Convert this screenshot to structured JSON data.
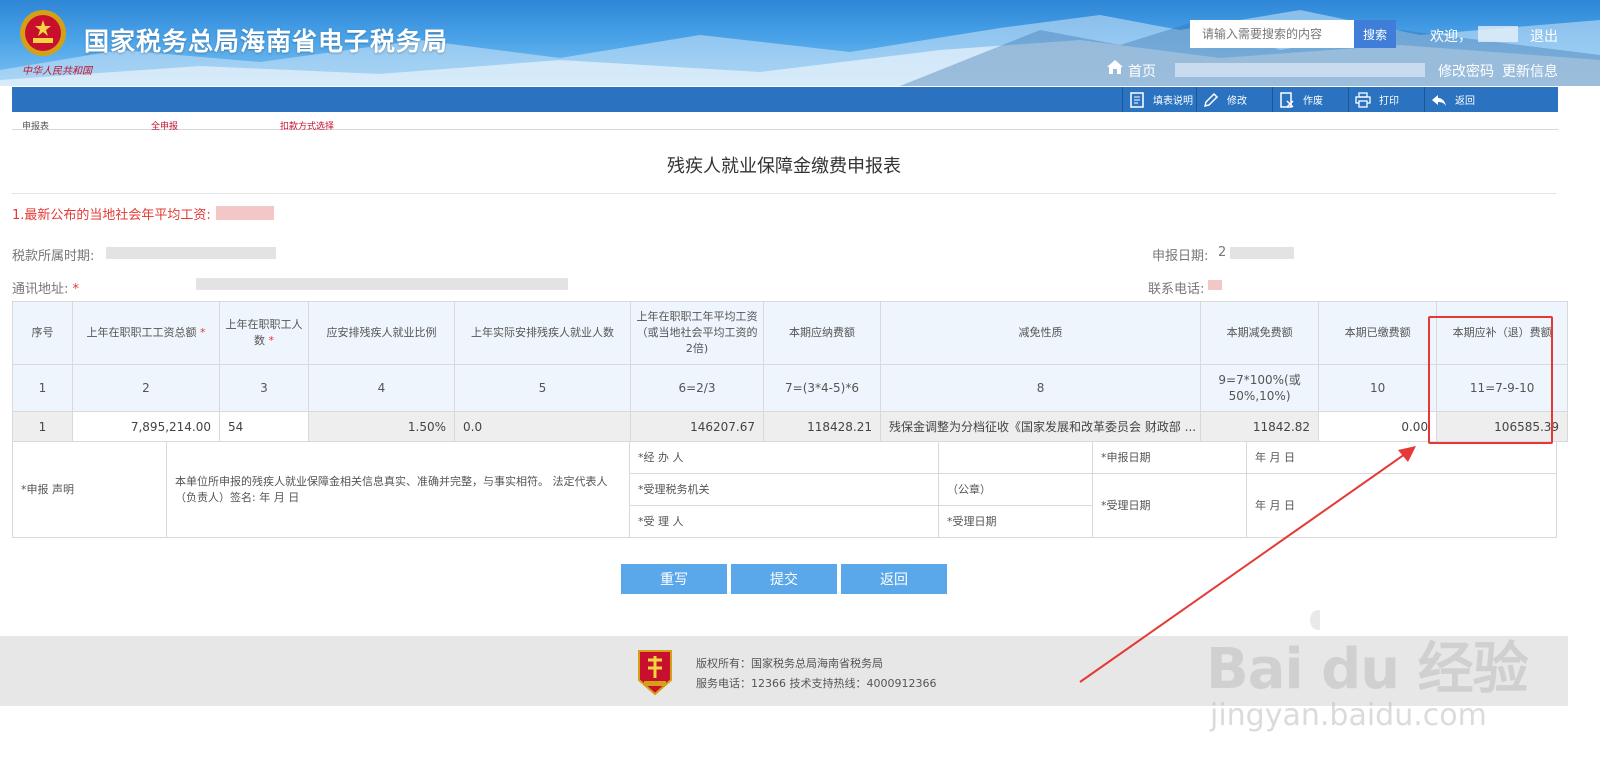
{
  "header": {
    "site_title": "国家税务总局海南省电子税务局",
    "emblem_sub": "中华人民共和国",
    "search_placeholder": "请输入需要搜索的内容",
    "search_button": "搜索",
    "welcome": "欢迎，",
    "logout": "退出",
    "home": "首页",
    "change_password": "修改密码",
    "update_info": "更新信息"
  },
  "toolbar": {
    "fill_instructions": "填表说明",
    "modify": "修改",
    "void": "作废",
    "print": "打印",
    "back": "返回"
  },
  "subnav": {
    "report_form": "申报表",
    "full_report": "全申报",
    "deduction_method": "扣款方式选择"
  },
  "form": {
    "title": "残疾人就业保障金缴费申报表",
    "notice": "1.最新公布的当地社会年平均工资:",
    "tax_period_label": "税款所属时期:",
    "report_date_label": "申报日期:",
    "report_date_prefix": "2",
    "address_label": "通讯地址:",
    "phone_label": "联系电话:",
    "required_mark": "*"
  },
  "table": {
    "headers": [
      "序号",
      "上年在职职工工资总额",
      "上年在职职工人数",
      "应安排残疾人就业比例",
      "上年实际安排残疾人就业人数",
      "上年在职职工年平均工资（或当地社会平均工资的2倍)",
      "本期应纳费额",
      "减免性质",
      "本期减免费额",
      "本期已缴费额",
      "本期应补（退）费额"
    ],
    "formula_row": [
      "1",
      "2",
      "3",
      "4",
      "5",
      "6=2/3",
      "7=(3*4-5)*6",
      "8",
      "9=7*100%(或50%,10%)",
      "10",
      "11=7-9-10"
    ],
    "data_row": {
      "seq": "1",
      "total_wages": "7,895,214.00",
      "employee_count": "54",
      "ratio": "1.50%",
      "disabled_count": "0.0",
      "avg_wage": "146207.67",
      "payable": "118428.21",
      "reduction_nature": "残保金调整为分档征收《国家发展和改革委员会 财政部 ...",
      "reduction_amount": "11842.82",
      "paid": "0.00",
      "due": "106585.39"
    }
  },
  "declaration": {
    "label": "*申报 声明",
    "text": "本单位所申报的残疾人就业保障金相关信息真实、准确并完整，与事实相符。 法定代表人（负责人）签名:   年 月 日",
    "agent": "*经 办 人",
    "tax_office": "*受理税务机关",
    "seal": "（公章）",
    "receiver": "*受 理 人",
    "accept_date_1": "*受理日期",
    "report_date": "*申报日期",
    "ymd_1": "年 月 日",
    "accept_date_2": "*受理日期",
    "ymd_2": "年 月 日"
  },
  "actions": {
    "rewrite": "重写",
    "submit": "提交",
    "back": "返回"
  },
  "footer": {
    "copyright": "版权所有：国家税务总局海南省税务局",
    "service": "服务电话：12366 技术支持热线：4000912366"
  },
  "watermark": {
    "brand": "Bai du 经验",
    "url": "jingyan.baidu.com"
  },
  "colors": {
    "header_blue": "#2e86d6",
    "toolbar_blue": "#2b73c0",
    "button_blue": "#5aa8ea",
    "accent_red": "#e53935"
  }
}
